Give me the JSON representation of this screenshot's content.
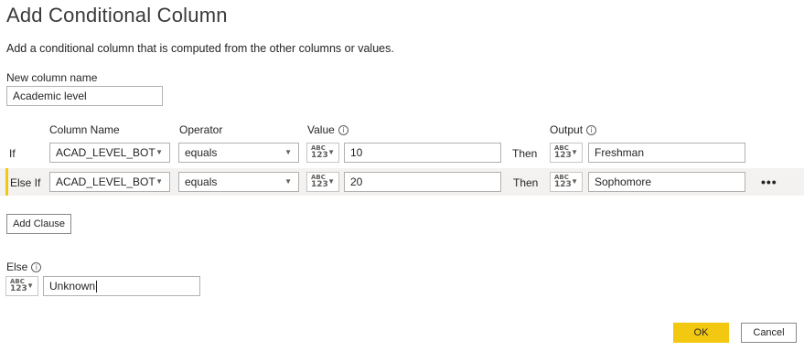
{
  "dialog": {
    "title": "Add Conditional Column",
    "description": "Add a conditional column that is computed from the other columns or values.",
    "new_column_label": "New column name",
    "new_column_value": "Academic level"
  },
  "headers": {
    "column_name": "Column Name",
    "operator": "Operator",
    "value": "Value",
    "output": "Output"
  },
  "clauses": [
    {
      "keyword": "If",
      "column": "ACAD_LEVEL_BOT",
      "operator": "equals",
      "value": "10",
      "then": "Then",
      "output": "Freshman"
    },
    {
      "keyword": "Else If",
      "column": "ACAD_LEVEL_BOT",
      "operator": "equals",
      "value": "20",
      "then": "Then",
      "output": "Sophomore"
    }
  ],
  "type_button": {
    "abc": "ABC",
    "num": "123",
    "icon": "chevron-down-icon"
  },
  "add_clause_label": "Add Clause",
  "more_label": "•••",
  "else": {
    "label": "Else",
    "value": "Unknown"
  },
  "info_icon": "i",
  "buttons": {
    "ok": "OK",
    "cancel": "Cancel"
  },
  "colors": {
    "accent": "#f2c811",
    "row_highlight": "#f3f2f1"
  }
}
